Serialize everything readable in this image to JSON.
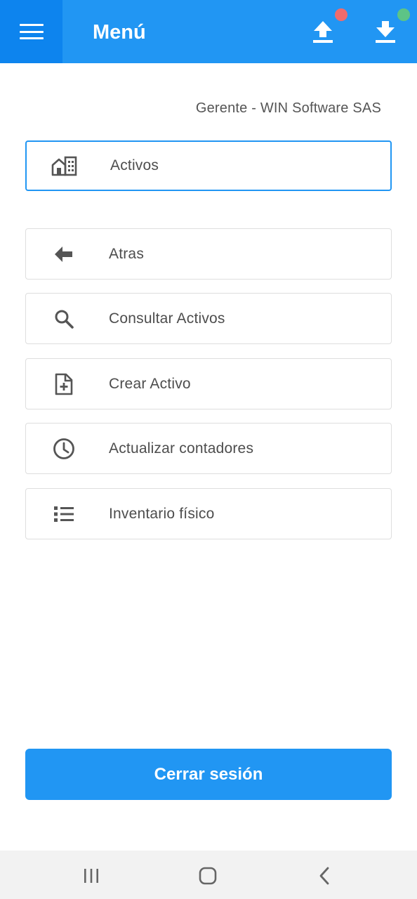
{
  "header": {
    "title": "Menú",
    "menu_icon": "hamburger-icon",
    "upload_icon": "upload-icon",
    "download_icon": "download-icon",
    "upload_status_color": "#f06b6b",
    "download_status_color": "#5dc486",
    "accent_color": "#2196f3"
  },
  "user": {
    "role_company": "Gerente - WIN Software SAS"
  },
  "module": {
    "label": "Activos",
    "icon": "buildings-icon"
  },
  "menu_items": [
    {
      "label": "Atras",
      "icon": "arrow-left-icon"
    },
    {
      "label": "Consultar Activos",
      "icon": "search-icon"
    },
    {
      "label": "Crear Activo",
      "icon": "add-file-icon"
    },
    {
      "label": "Actualizar contadores",
      "icon": "clock-icon"
    },
    {
      "label": "Inventario físico",
      "icon": "list-icon"
    }
  ],
  "logout": {
    "label": "Cerrar sesión"
  },
  "system_nav": {
    "recents_icon": "recents-icon",
    "home_icon": "home-icon",
    "back_icon": "back-icon"
  }
}
